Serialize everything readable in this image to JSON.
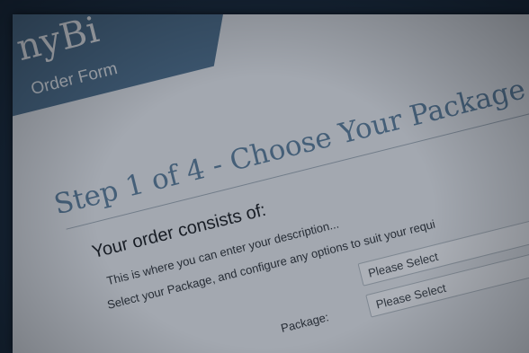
{
  "header": {
    "brand": "nyBi",
    "subtitle": "Order Form"
  },
  "step": {
    "title": "Step 1 of 4 - Choose Your Package"
  },
  "order": {
    "heading": "Your order consists of:",
    "description": "This is where you can enter your description...",
    "instruction": "Select your Package, and configure any options to suit your requi"
  },
  "form": {
    "package_label": "Package:",
    "select_1": "Please Select",
    "select_2": "Please Select"
  },
  "colors": {
    "background": "#17283a",
    "banner": "#4e6f8c",
    "title": "#5b7c98",
    "paper": "#e1e4e8"
  }
}
